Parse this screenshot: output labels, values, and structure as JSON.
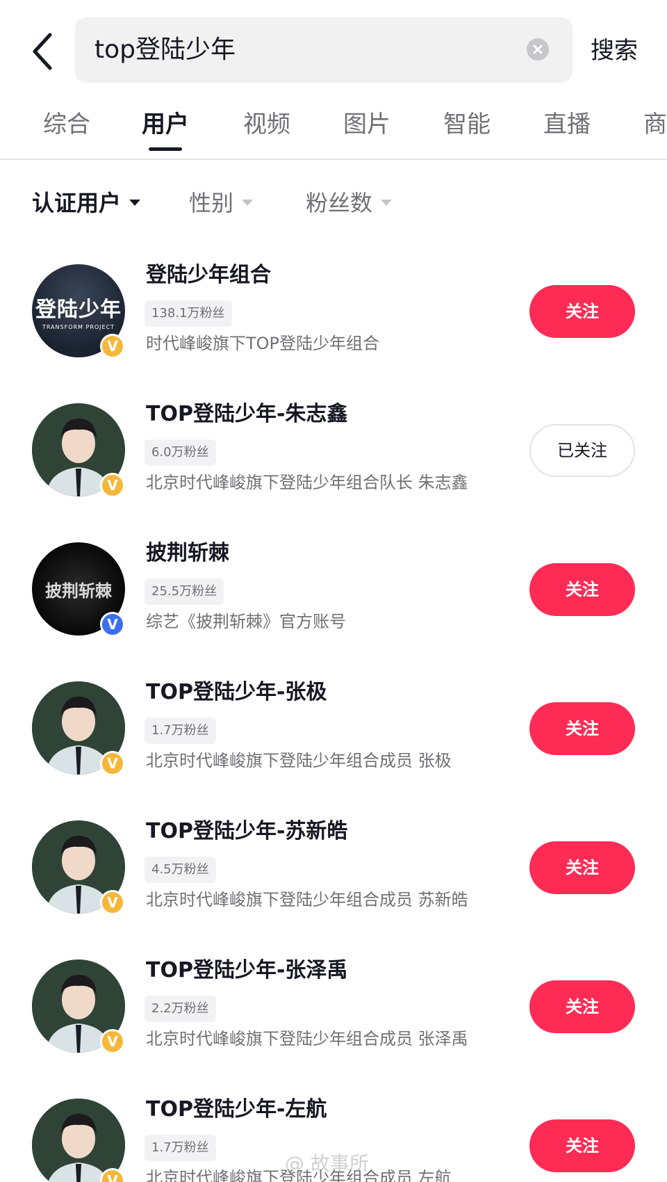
{
  "header": {
    "back_icon": "chevron-left-icon",
    "search_value": "top登陆少年",
    "clear_icon": "clear-icon",
    "search_button": "搜索"
  },
  "tabs": [
    {
      "label": "综合",
      "active": false
    },
    {
      "label": "用户",
      "active": true
    },
    {
      "label": "视频",
      "active": false
    },
    {
      "label": "图片",
      "active": false
    },
    {
      "label": "智能",
      "active": false
    },
    {
      "label": "直播",
      "active": false
    },
    {
      "label": "商",
      "active": false
    }
  ],
  "filters": [
    {
      "label": "认证用户",
      "active": true
    },
    {
      "label": "性别",
      "active": false
    },
    {
      "label": "粉丝数",
      "active": false
    }
  ],
  "results": [
    {
      "name": "登陆少年组合",
      "fans": "138.1万粉丝",
      "desc": "时代峰峻旗下TOP登陆少年组合",
      "button": "关注",
      "followed": false,
      "verified": "V",
      "badge_color": "#f5b73b",
      "avatar_text": "登陆少年",
      "avatar_subtext": "TRANSFORM PROJECT"
    },
    {
      "name": "TOP登陆少年-朱志鑫",
      "fans": "6.0万粉丝",
      "desc": "北京时代峰峻旗下登陆少年组合队长 朱志鑫",
      "button": "已关注",
      "followed": true,
      "verified": "V",
      "badge_color": "#f5b73b"
    },
    {
      "name": "披荆斩棘",
      "fans": "25.5万粉丝",
      "desc": "综艺《披荆斩棘》官方账号",
      "button": "关注",
      "followed": false,
      "verified": "V",
      "badge_color": "#3b6ff0",
      "avatar_text": "披荆斩棘"
    },
    {
      "name": "TOP登陆少年-张极",
      "fans": "1.7万粉丝",
      "desc": "北京时代峰峻旗下登陆少年组合成员 张极",
      "button": "关注",
      "followed": false,
      "verified": "V",
      "badge_color": "#f5b73b"
    },
    {
      "name": "TOP登陆少年-苏新皓",
      "fans": "4.5万粉丝",
      "desc": "北京时代峰峻旗下登陆少年组合成员 苏新皓",
      "button": "关注",
      "followed": false,
      "verified": "V",
      "badge_color": "#f5b73b"
    },
    {
      "name": "TOP登陆少年-张泽禹",
      "fans": "2.2万粉丝",
      "desc": "北京时代峰峻旗下登陆少年组合成员 张泽禹",
      "button": "关注",
      "followed": false,
      "verified": "V",
      "badge_color": "#f5b73b"
    },
    {
      "name": "TOP登陆少年-左航",
      "fans": "1.7万粉丝",
      "desc": "北京时代峰峻旗下登陆少年组合成员 左航",
      "button": "关注",
      "followed": false,
      "verified": "V",
      "badge_color": "#f5b73b"
    }
  ],
  "colors": {
    "accent": "#fe2c55",
    "verified_gold": "#f5b73b",
    "verified_blue": "#3b6ff0"
  },
  "watermark": "@ 故事所"
}
